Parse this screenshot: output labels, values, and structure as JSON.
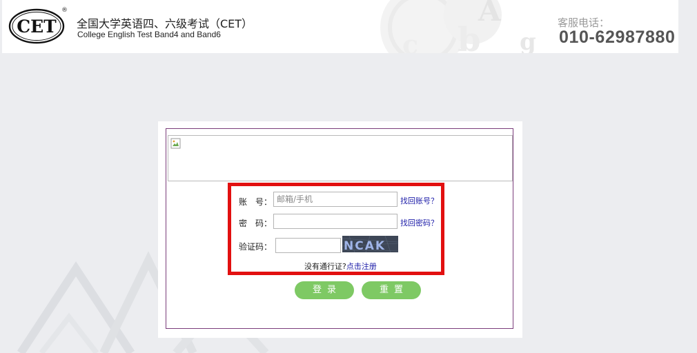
{
  "header": {
    "logo_text": "CET",
    "logo_registered": "®",
    "title_cn": "全国大学英语四、六级考试（CET）",
    "title_en": "College English Test Band4 and Band6",
    "hotline_label": "客服电话：",
    "hotline_number": "010-62987880"
  },
  "login": {
    "account_label": "账　号：",
    "account_placeholder": "邮箱/手机",
    "find_account_link": "找回账号？",
    "password_label": "密　码：",
    "password_value": "",
    "find_password_link": "找回密码？",
    "captcha_label": "验证码：",
    "captcha_value": "",
    "captcha_image_text": "NCAK",
    "register_prompt": "没有通行证?",
    "register_link": "点击注册",
    "login_button": "登录",
    "reset_button": "重置"
  },
  "colors": {
    "background": "#ecedf0",
    "button_green": "#7ec964",
    "highlight_red": "#e21010",
    "panel_border": "#7a3b7a",
    "link_blue": "#1c1ca8"
  }
}
